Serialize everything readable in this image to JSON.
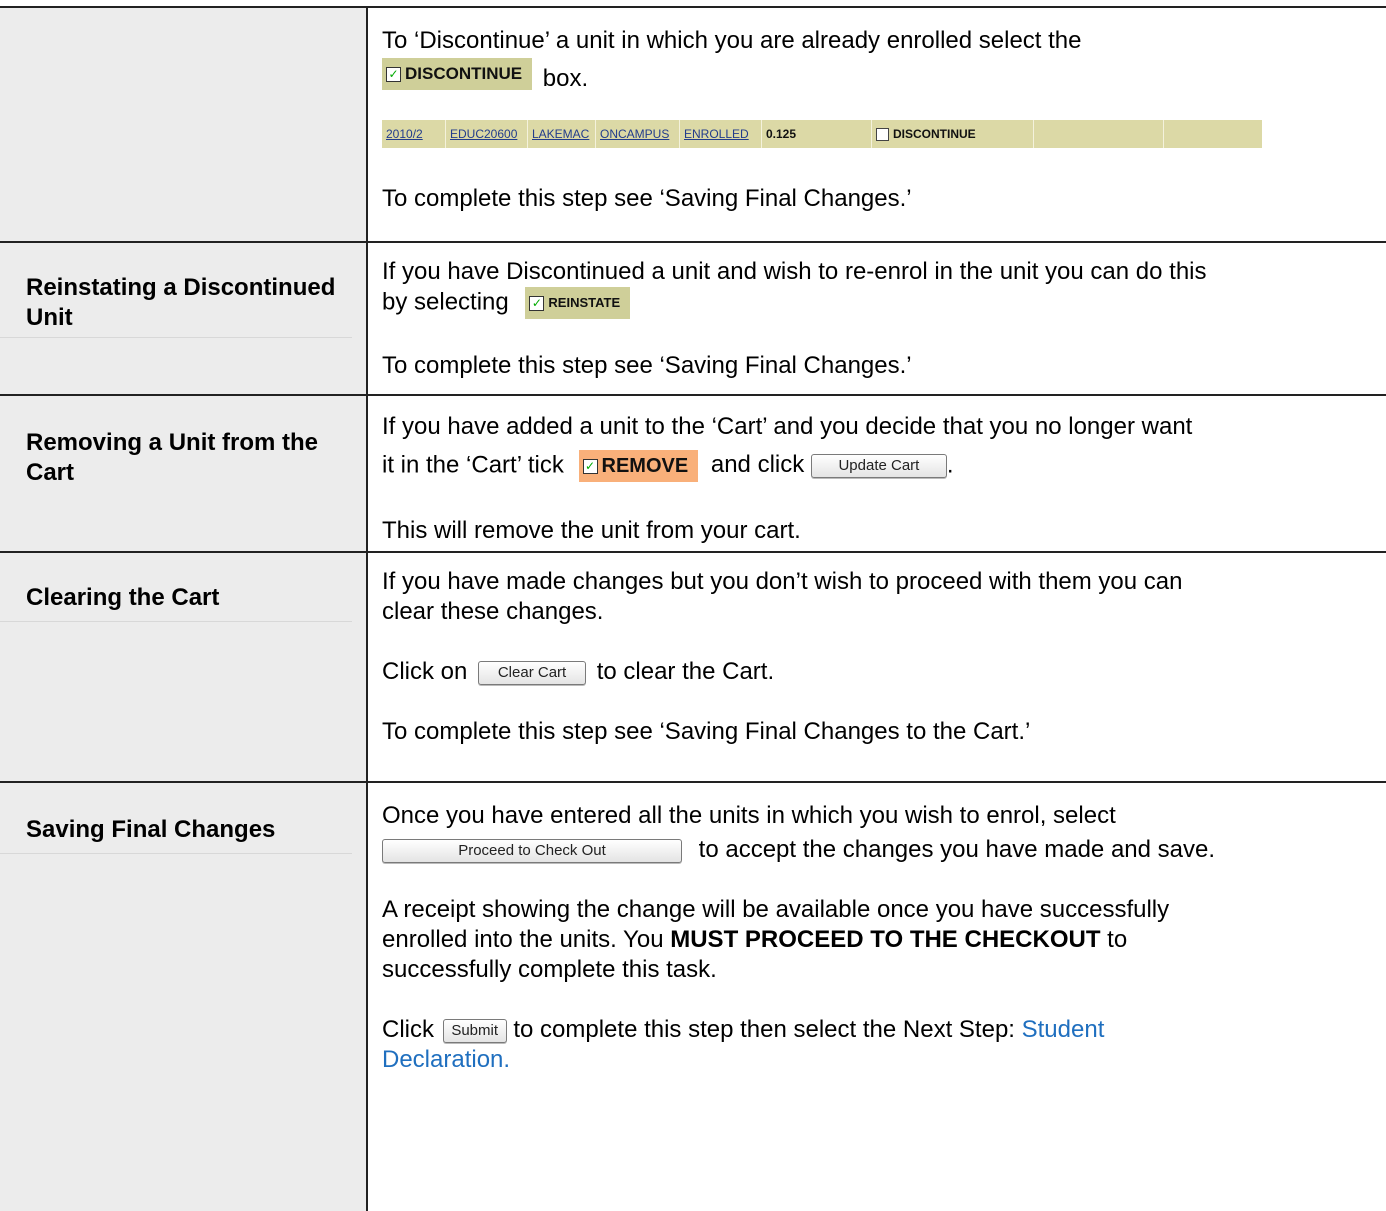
{
  "rows": [
    {
      "label": "",
      "intro_before": "To ‘Discontinue’ a unit in which you are already enrolled select the",
      "discontinue_chip": "DISCONTINUE",
      "intro_after": "box.",
      "record": {
        "period": "2010/2",
        "unit_code": "EDUC20600",
        "campus": "LAKEMAC",
        "mode": "ONCAMPUS",
        "status": "ENROLLED",
        "load": "0.125",
        "action": "DISCONTINUE"
      },
      "complete_note": "To complete this step see ‘Saving Final Changes.’"
    },
    {
      "label": "Reinstating a Discontinued Unit",
      "line1": "If you have Discontinued a unit and wish to re-enrol in the unit you can do this",
      "line2_before": "by selecting",
      "reinstate_chip": "REINSTATE",
      "complete_note": "To complete this step see ‘Saving Final Changes.’"
    },
    {
      "label": "Removing a Unit from the Cart",
      "line1": "If you have added a unit to the ‘Cart’ and you decide that you no longer want",
      "line2_before": "it in the ‘Cart’ tick",
      "remove_chip": "REMOVE",
      "line2_middle": "and click",
      "update_button": "Update Cart",
      "line2_after": ".",
      "note": "This will remove the unit from your cart."
    },
    {
      "label": "Clearing the Cart",
      "line1": "If you have made changes but you don’t wish to proceed with them you can",
      "line2": "clear these changes.",
      "click_before": "Click on",
      "clear_button": "Clear Cart",
      "click_after": "to clear the Cart.",
      "complete_note": "To complete this step see ‘Saving Final Changes to the Cart.’"
    },
    {
      "label": "Saving Final Changes",
      "line1": "Once you have entered all the units in which you wish to enrol, select",
      "checkout_button": "Proceed to Check Out",
      "line2_after": "to accept the changes you have made and save.",
      "receipt_line1": "A receipt showing the change will be available once you have successfully",
      "receipt_line2_before": "enrolled into the units. You",
      "receipt_bold": "MUST PROCEED TO THE CHECKOUT",
      "receipt_line2_after": "to",
      "receipt_line3": "successfully complete this task.",
      "click_before": "Click",
      "submit_button": "Submit",
      "click_after": "to complete this step then select the Next Step:",
      "link_line1": "Student",
      "link_line2": "Declaration."
    }
  ]
}
